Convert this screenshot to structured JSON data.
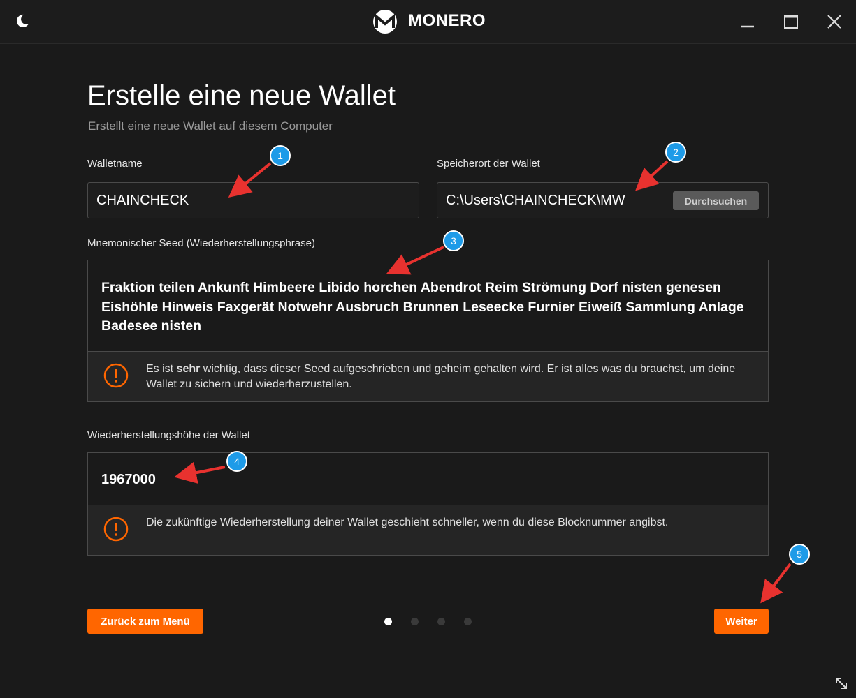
{
  "window": {
    "title": "MONERO",
    "theme_icon": "moon-icon",
    "logo_icon": "monero-logo-icon",
    "controls": [
      "minimize-icon",
      "maximize-icon",
      "close-icon"
    ]
  },
  "page": {
    "title": "Erstelle eine neue Wallet",
    "subtitle": "Erstellt eine neue Wallet auf diesem Computer"
  },
  "wallet_name": {
    "label": "Walletname",
    "value": "CHAINCHECK"
  },
  "wallet_location": {
    "label": "Speicherort der Wallet",
    "value": "C:\\Users\\CHAINCHECK\\MW",
    "browse_label": "Durchsuchen"
  },
  "seed": {
    "label": "Mnemonischer Seed (Wiederherstellungsphrase)",
    "text": "Fraktion teilen Ankunft Himbeere Libido horchen Abendrot Reim Strömung Dorf nisten genesen Eishöhle Hinweis Faxgerät Notwehr Ausbruch Brunnen Leseecke Furnier Eiweiß Sammlung Anlage Badesee nisten",
    "warning_prefix": "Es ist ",
    "warning_bold": "sehr",
    "warning_suffix": " wichtig, dass dieser Seed aufgeschrieben und geheim gehalten wird. Er ist alles was du brauchst, um deine Wallet zu sichern und wiederherzustellen."
  },
  "restore_height": {
    "label": "Wiederherstellungshöhe der Wallet",
    "value": "1967000",
    "warning": "Die zukünftige Wiederherstellung deiner Wallet geschieht schneller, wenn du diese Blocknummer angibst."
  },
  "navigation": {
    "back_label": "Zurück zum Menü",
    "next_label": "Weiter",
    "total_steps": 4,
    "current_step": 1
  },
  "annotations": [
    "1",
    "2",
    "3",
    "4",
    "5"
  ],
  "colors": {
    "accent": "#ff6600",
    "background": "#1a1a1a",
    "badge": "#1e9be8",
    "arrow": "#e8322f"
  }
}
